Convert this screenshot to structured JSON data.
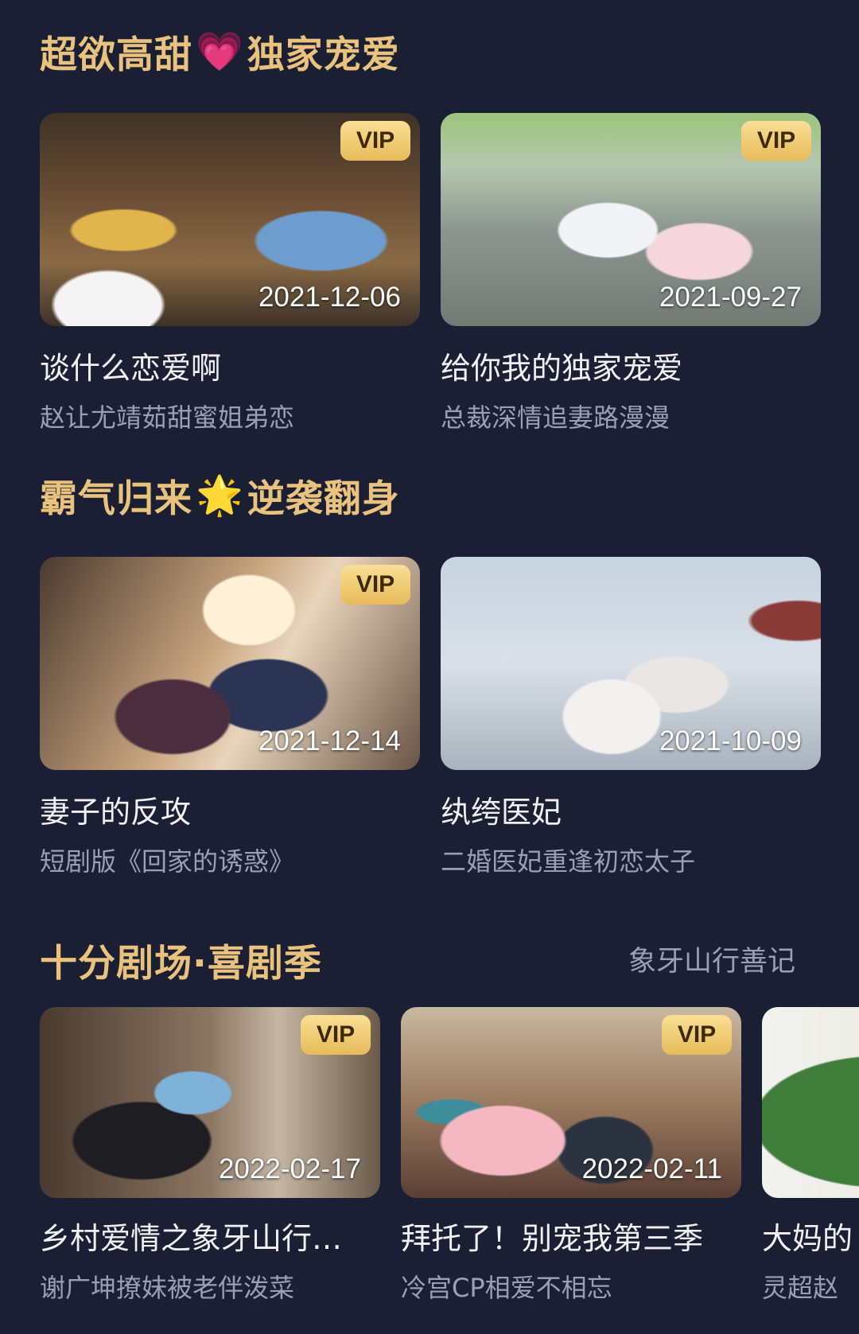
{
  "sections": [
    {
      "title_left": "超欲高甜",
      "emoji": "💗",
      "title_right": "独家宠爱",
      "cards": [
        {
          "vip": "VIP",
          "date": "2021-12-06",
          "title": "谈什么恋爱啊",
          "subtitle": "赵让尤靖茹甜蜜姐弟恋"
        },
        {
          "vip": "VIP",
          "date": "2021-09-27",
          "title": "给你我的独家宠爱",
          "subtitle": "总裁深情追妻路漫漫"
        }
      ]
    },
    {
      "title_left": "霸气归来",
      "emoji": "🌟",
      "title_right": "逆袭翻身",
      "cards": [
        {
          "vip": "VIP",
          "date": "2021-12-14",
          "title": "妻子的反攻",
          "subtitle": "短剧版《回家的诱惑》"
        },
        {
          "date": "2021-10-09",
          "title": "纨绔医妃",
          "subtitle": "二婚医妃重逢初恋太子"
        }
      ]
    },
    {
      "title": "十分剧场·喜剧季",
      "link": "象牙山行善记",
      "cards": [
        {
          "vip": "VIP",
          "date": "2022-02-17",
          "title": "乡村爱情之象牙山行…",
          "subtitle": "谢广坤撩妹被老伴泼菜"
        },
        {
          "vip": "VIP",
          "date": "2022-02-11",
          "title": "拜托了！别宠我第三季",
          "subtitle": "冷宫CP相爱不相忘"
        },
        {
          "title": "大妈的",
          "subtitle": "灵超赵"
        }
      ]
    }
  ]
}
